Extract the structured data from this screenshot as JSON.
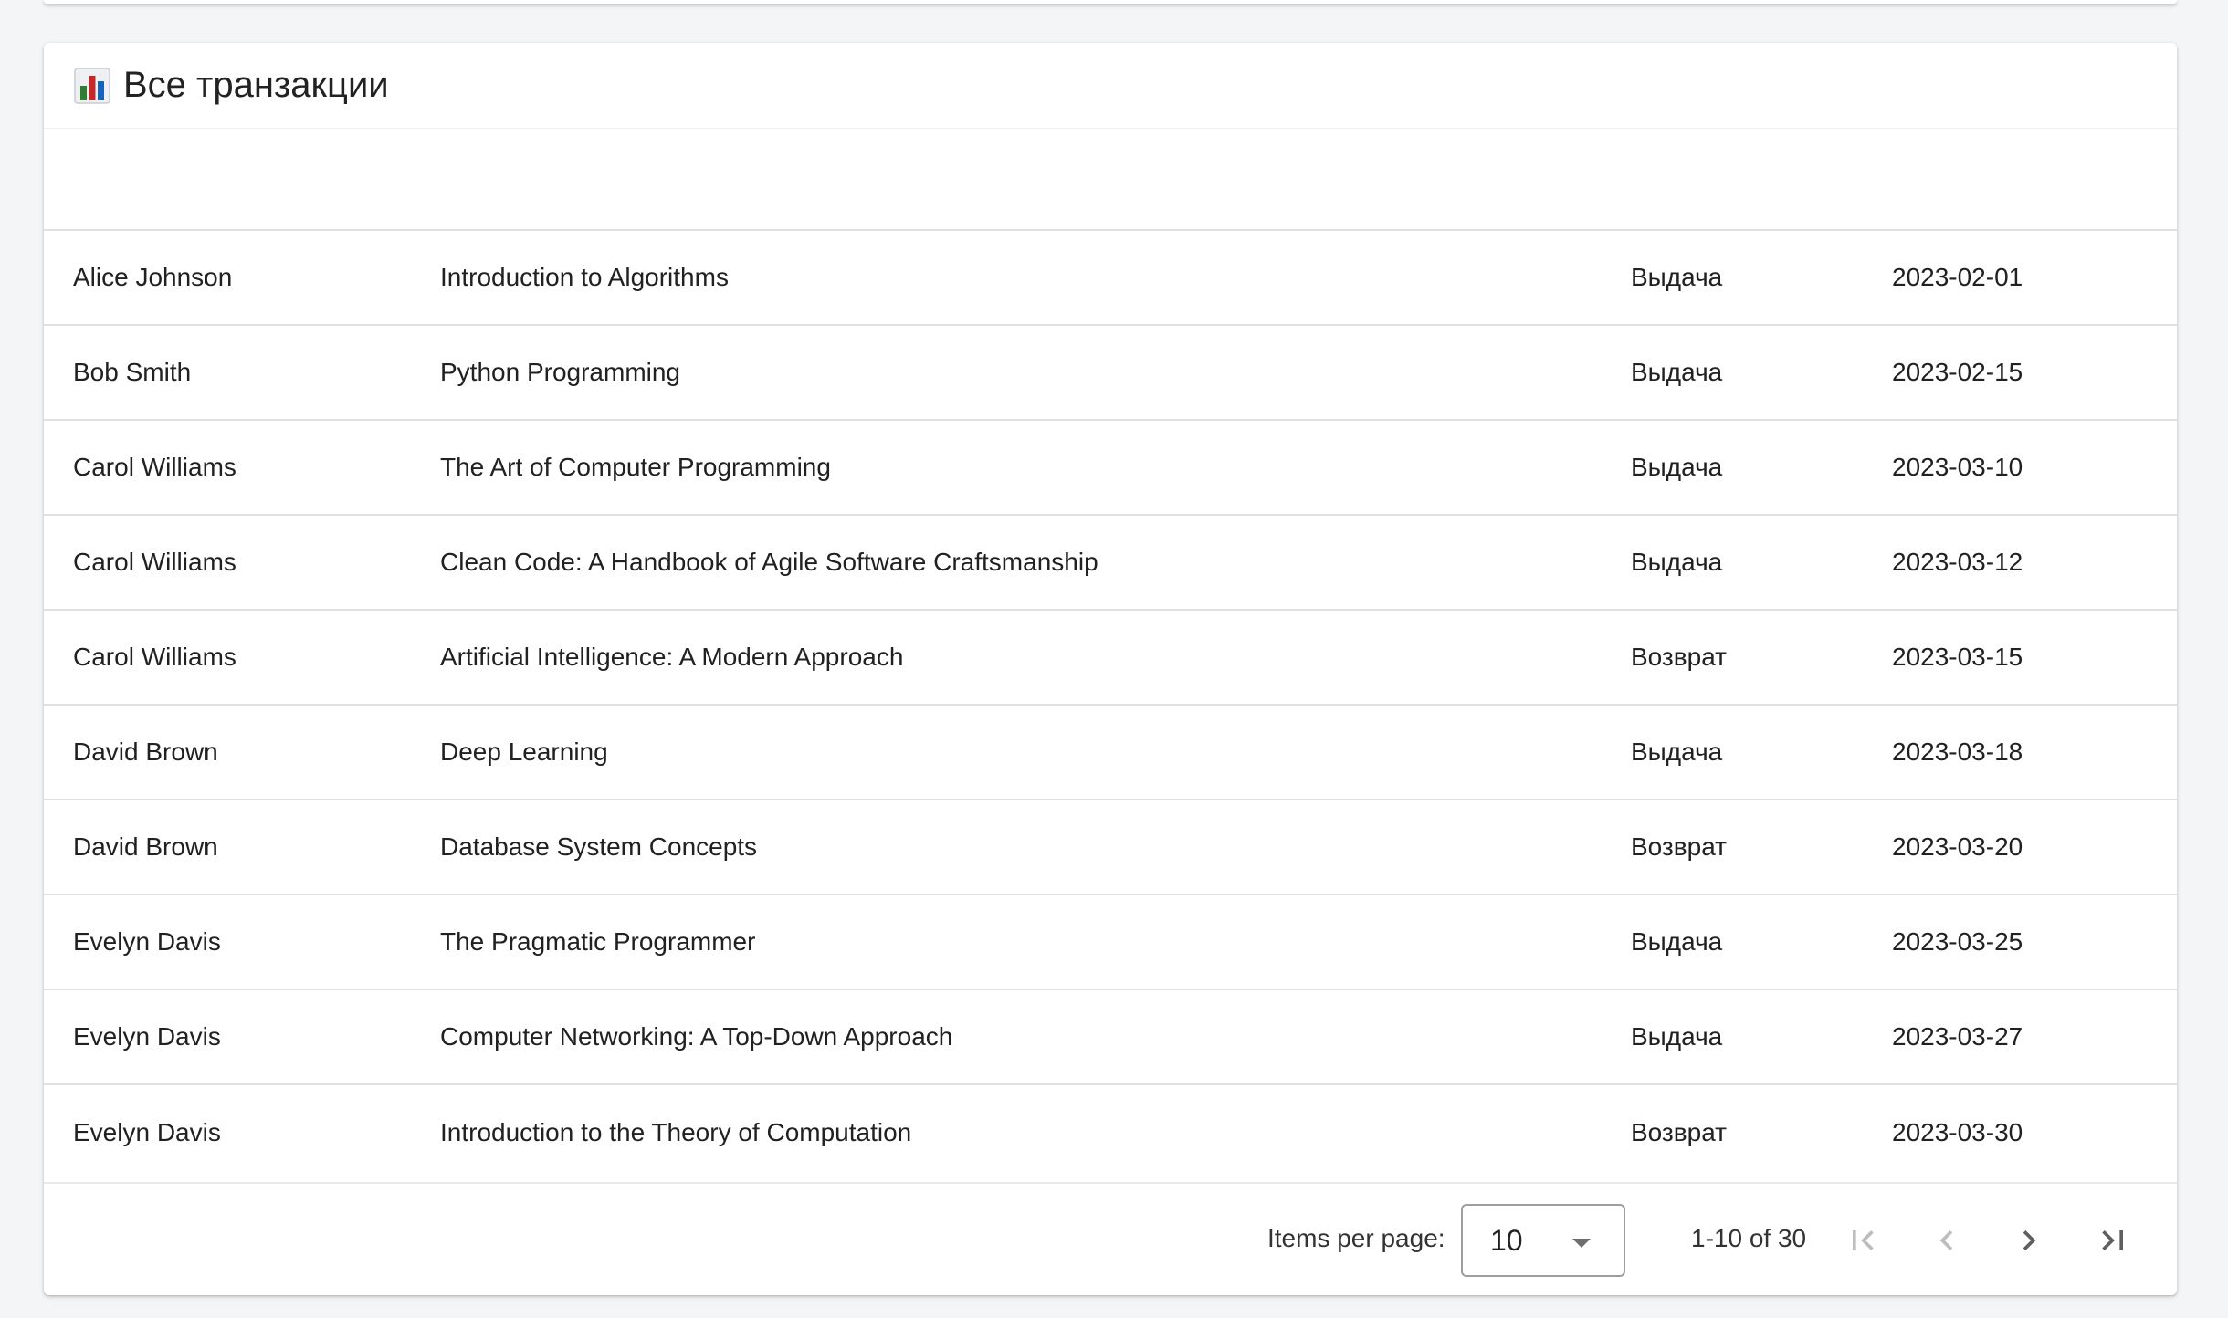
{
  "page": {
    "title": "Все транзакции",
    "title_icon": "bar-chart-icon"
  },
  "table": {
    "rows": [
      {
        "user": "Alice Johnson",
        "book": "Introduction to Algorithms",
        "type": "Выдача",
        "date": "2023-02-01"
      },
      {
        "user": "Bob Smith",
        "book": "Python Programming",
        "type": "Выдача",
        "date": "2023-02-15"
      },
      {
        "user": "Carol Williams",
        "book": "The Art of Computer Programming",
        "type": "Выдача",
        "date": "2023-03-10"
      },
      {
        "user": "Carol Williams",
        "book": "Clean Code: A Handbook of Agile Software Craftsmanship",
        "type": "Выдача",
        "date": "2023-03-12"
      },
      {
        "user": "Carol Williams",
        "book": "Artificial Intelligence: A Modern Approach",
        "type": "Возврат",
        "date": "2023-03-15"
      },
      {
        "user": "David Brown",
        "book": "Deep Learning",
        "type": "Выдача",
        "date": "2023-03-18"
      },
      {
        "user": "David Brown",
        "book": "Database System Concepts",
        "type": "Возврат",
        "date": "2023-03-20"
      },
      {
        "user": "Evelyn Davis",
        "book": "The Pragmatic Programmer",
        "type": "Выдача",
        "date": "2023-03-25"
      },
      {
        "user": "Evelyn Davis",
        "book": "Computer Networking: A Top-Down Approach",
        "type": "Выдача",
        "date": "2023-03-27"
      },
      {
        "user": "Evelyn Davis",
        "book": "Introduction to the Theory of Computation",
        "type": "Возврат",
        "date": "2023-03-30"
      }
    ]
  },
  "paginator": {
    "items_per_page_label": "Items per page:",
    "items_per_page_value": "10",
    "range_label": "1-10 of 30",
    "icons": {
      "first": "first-page-icon",
      "prev": "chevron-left-icon",
      "next": "chevron-right-icon",
      "last": "last-page-icon"
    }
  },
  "colors": {
    "background": "#f4f5f7",
    "card": "#ffffff",
    "divider": "#e0e0e0",
    "disabled_icon": "#bdbdbd",
    "active_icon": "#5f5f5f"
  }
}
